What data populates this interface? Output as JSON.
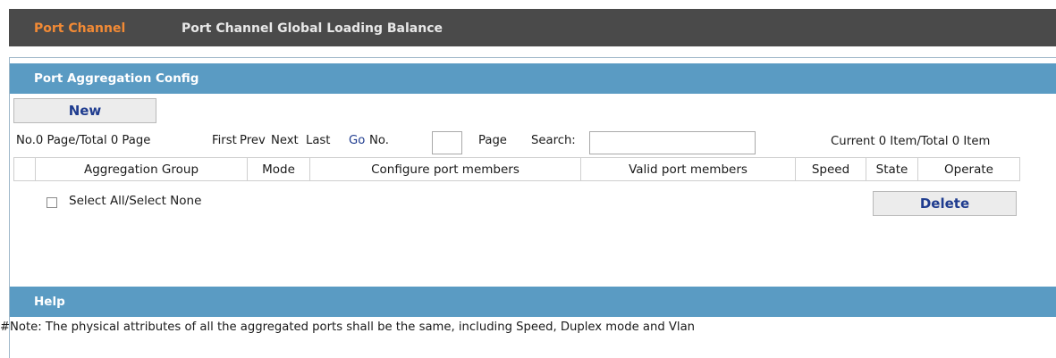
{
  "tabs": [
    {
      "label": "Port Channel",
      "active": true
    },
    {
      "label": "Port Channel Global Loading Balance",
      "active": false
    }
  ],
  "config_section": {
    "title": "Port Aggregation Config"
  },
  "new_button": "New",
  "pager": {
    "page_info": "No.0 Page/Total 0 Page",
    "first": "First",
    "prev": "Prev",
    "next": "Next",
    "last": "Last",
    "go": "Go",
    "no": "No.",
    "page_no_value": "",
    "page": "Page",
    "search": "Search:",
    "search_value": "",
    "item_count": "Current 0 Item/Total 0 Item"
  },
  "table": {
    "columns": [
      "",
      "Aggregation Group",
      "Mode",
      "Configure port members",
      "Valid port members",
      "Speed",
      "State",
      "Operate"
    ],
    "rows": []
  },
  "select_all": {
    "label": "Select All/Select None",
    "checked": false
  },
  "delete_button": "Delete",
  "help_section": {
    "title": "Help",
    "note": "#Note: The physical attributes of all the aggregated ports shall be the same, including Speed, Duplex mode and Vlan"
  },
  "colors": {
    "tabbar_bg": "#4a4a4a",
    "active_tab": "#f28a35",
    "section_bar": "#5a9bc3",
    "button_text": "#1f3c8f"
  }
}
